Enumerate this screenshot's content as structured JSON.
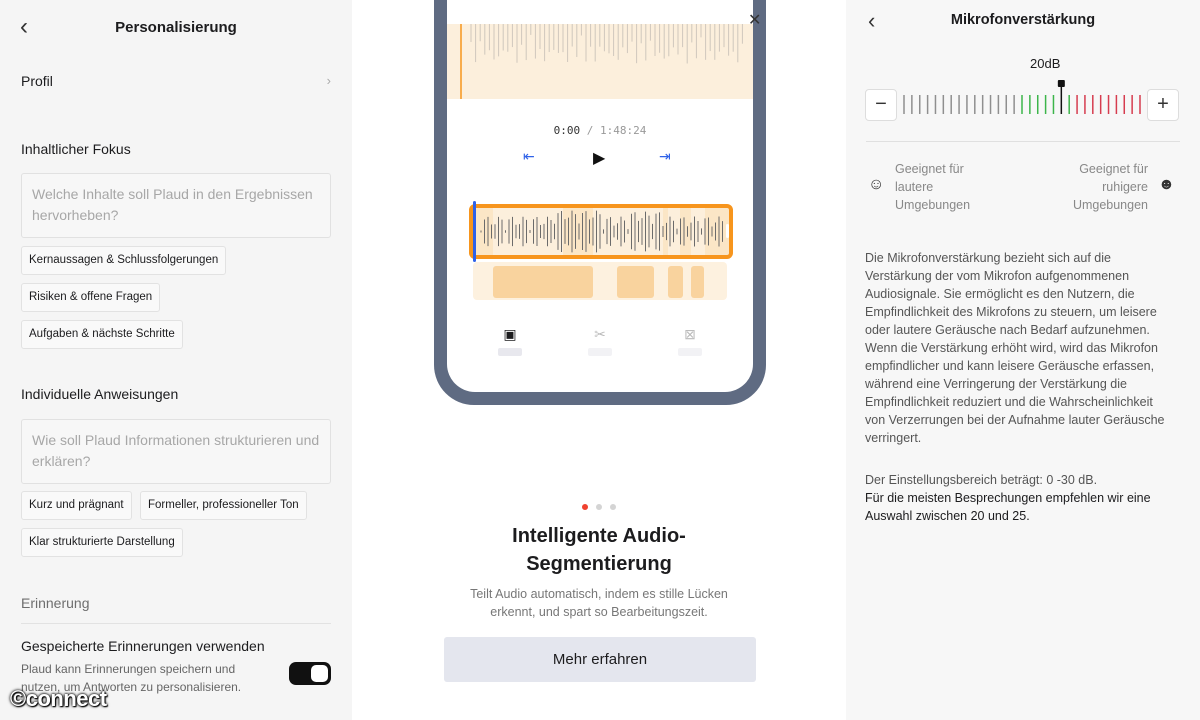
{
  "left": {
    "title": "Personalisierung",
    "profil": "Profil",
    "focus_heading": "Inhaltlicher Fokus",
    "focus_placeholder": "Welche Inhalte soll Plaud in den Ergebnissen hervorheben?",
    "focus_chips": [
      "Kernaussagen & Schlussfolgerungen",
      "Risiken & offene Fragen",
      "Aufgaben & nächste Schritte"
    ],
    "instr_heading": "Individuelle Anweisungen",
    "instr_placeholder": "Wie soll Plaud Informationen strukturieren und erklären?",
    "instr_chips": [
      "Kurz und prägnant",
      "Formeller, professioneller Ton",
      "Klar strukturierte Darstellung"
    ],
    "memory_heading": "Erinnerung",
    "memory_title": "Gespeicherte Erinnerungen verwenden",
    "memory_desc": "Plaud kann Erinnerungen speichern und nutzen, um Antworten zu personalisieren.",
    "memory_enabled": true,
    "watermark": "©connect"
  },
  "mid": {
    "time_current": "0:00",
    "time_separator": "/",
    "time_total": "1:48:24",
    "slide_index": 0,
    "slide_count": 3,
    "title": "Intelligente Audio-Segmentierung",
    "desc": "Teilt Audio automatisch, indem es stille Lücken erkennt, und spart so Bearbeitungszeit.",
    "button": "Mehr erfahren",
    "icons": [
      "close-icon",
      "skip-back-icon",
      "play-icon",
      "skip-forward-icon",
      "ai-segment-icon",
      "scissors-icon",
      "delete-silence-icon"
    ]
  },
  "right": {
    "title": "Mikrofonverstärkung",
    "value_label": "20dB",
    "gain_value_db": 20,
    "range_db": [
      0,
      30
    ],
    "colors": {
      "low": "#8f8f8f",
      "good": "#3cb54a",
      "high": "#d63c4f"
    },
    "env_loud_1": "Geeignet für",
    "env_loud_2": "lautere",
    "env_loud_3": "Umgebungen",
    "env_quiet_1": "Geeignet für",
    "env_quiet_2": "ruhigere",
    "env_quiet_3": "Umgebungen",
    "description": "Die Mikrofonverstärkung bezieht sich auf die Verstärkung der vom Mikrofon aufgenommenen Audiosignale. Sie ermöglicht es den Nutzern, die Empfindlichkeit des Mikrofons zu steuern, um leisere oder lautere Geräusche nach Bedarf aufzunehmen. Wenn die Verstärkung erhöht wird, wird das Mikrofon empfindlicher und kann leisere Geräusche erfassen, während eine Verringerung der Verstärkung die Empfindlichkeit reduziert und die Wahrscheinlichkeit von Verzerrungen bei der Aufnahme lauter Geräusche verringert.",
    "range_text": "Der Einstellungsbereich beträgt: 0 -30 dB.",
    "recommend_text": "Für die meisten Besprechungen empfehlen wir eine Auswahl zwischen 20 und 25."
  }
}
